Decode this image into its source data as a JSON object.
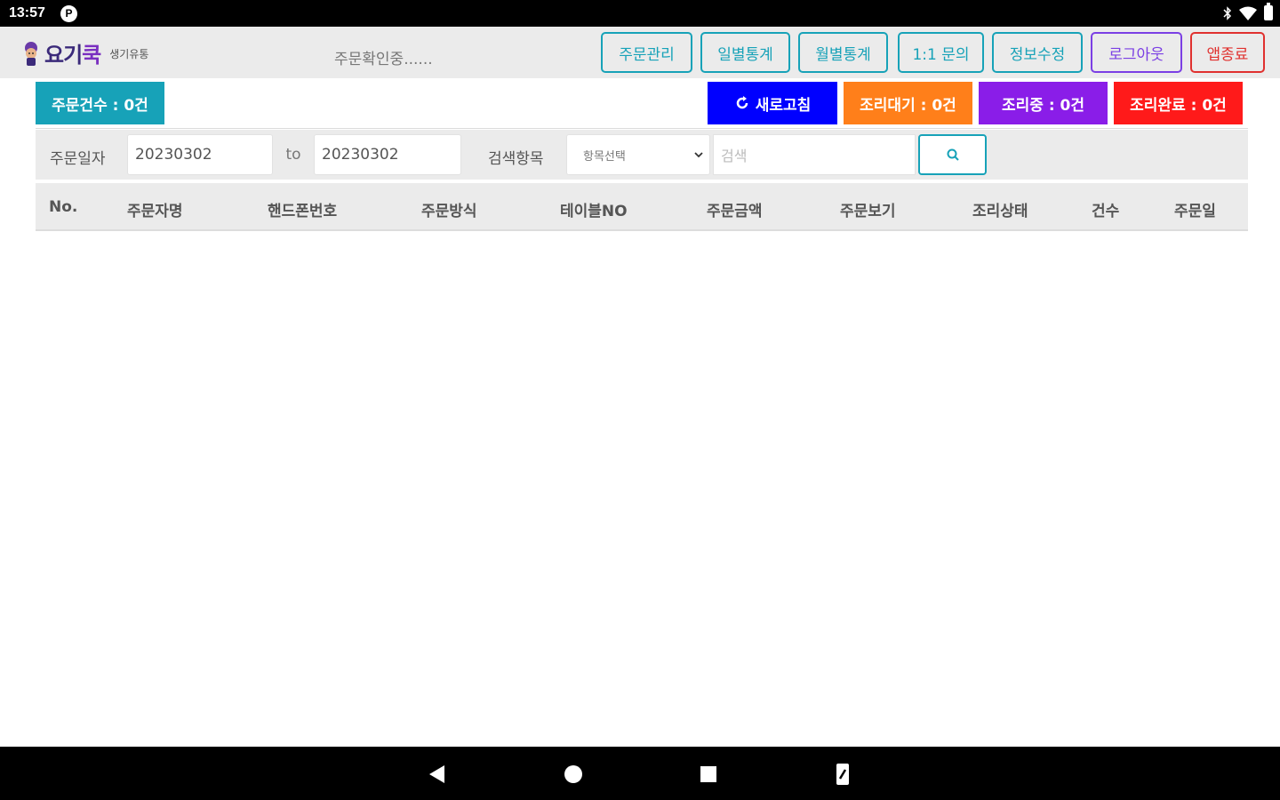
{
  "status_bar": {
    "time": "13:57",
    "app_icon_letter": "P"
  },
  "header": {
    "logo_main": "요기",
    "logo_accent": "쿡",
    "logo_sub": "생기유통",
    "order_status": "주문확인중......",
    "nav": [
      {
        "label": "주문관리"
      },
      {
        "label": "일별통계"
      },
      {
        "label": "월별통계"
      },
      {
        "label": "1:1 문의"
      },
      {
        "label": "정보수정"
      },
      {
        "label": "로그아웃"
      },
      {
        "label": "앱종료"
      }
    ]
  },
  "summary": {
    "order_count": "주문건수 : 0건",
    "refresh": "새로고침",
    "cook_wait": "조리대기 : 0건",
    "cooking": "조리중 : 0건",
    "cook_done": "조리완료 : 0건"
  },
  "filter": {
    "date_label": "주문일자",
    "date_from": "20230302",
    "to_label": "to",
    "date_to": "20230302",
    "search_label": "검색항목",
    "select_value": "항목선택",
    "search_placeholder": "검색"
  },
  "table": {
    "columns": [
      "No.",
      "주문자명",
      "핸드폰번호",
      "주문방식",
      "테이블NO",
      "주문금액",
      "주문보기",
      "조리상태",
      "건수",
      "주문일"
    ],
    "rows": []
  },
  "colors": {
    "teal": "#17a2b8",
    "blue": "#0000ff",
    "orange": "#ff7f1a",
    "purple": "#8a1de8",
    "red": "#ff1a1a"
  }
}
